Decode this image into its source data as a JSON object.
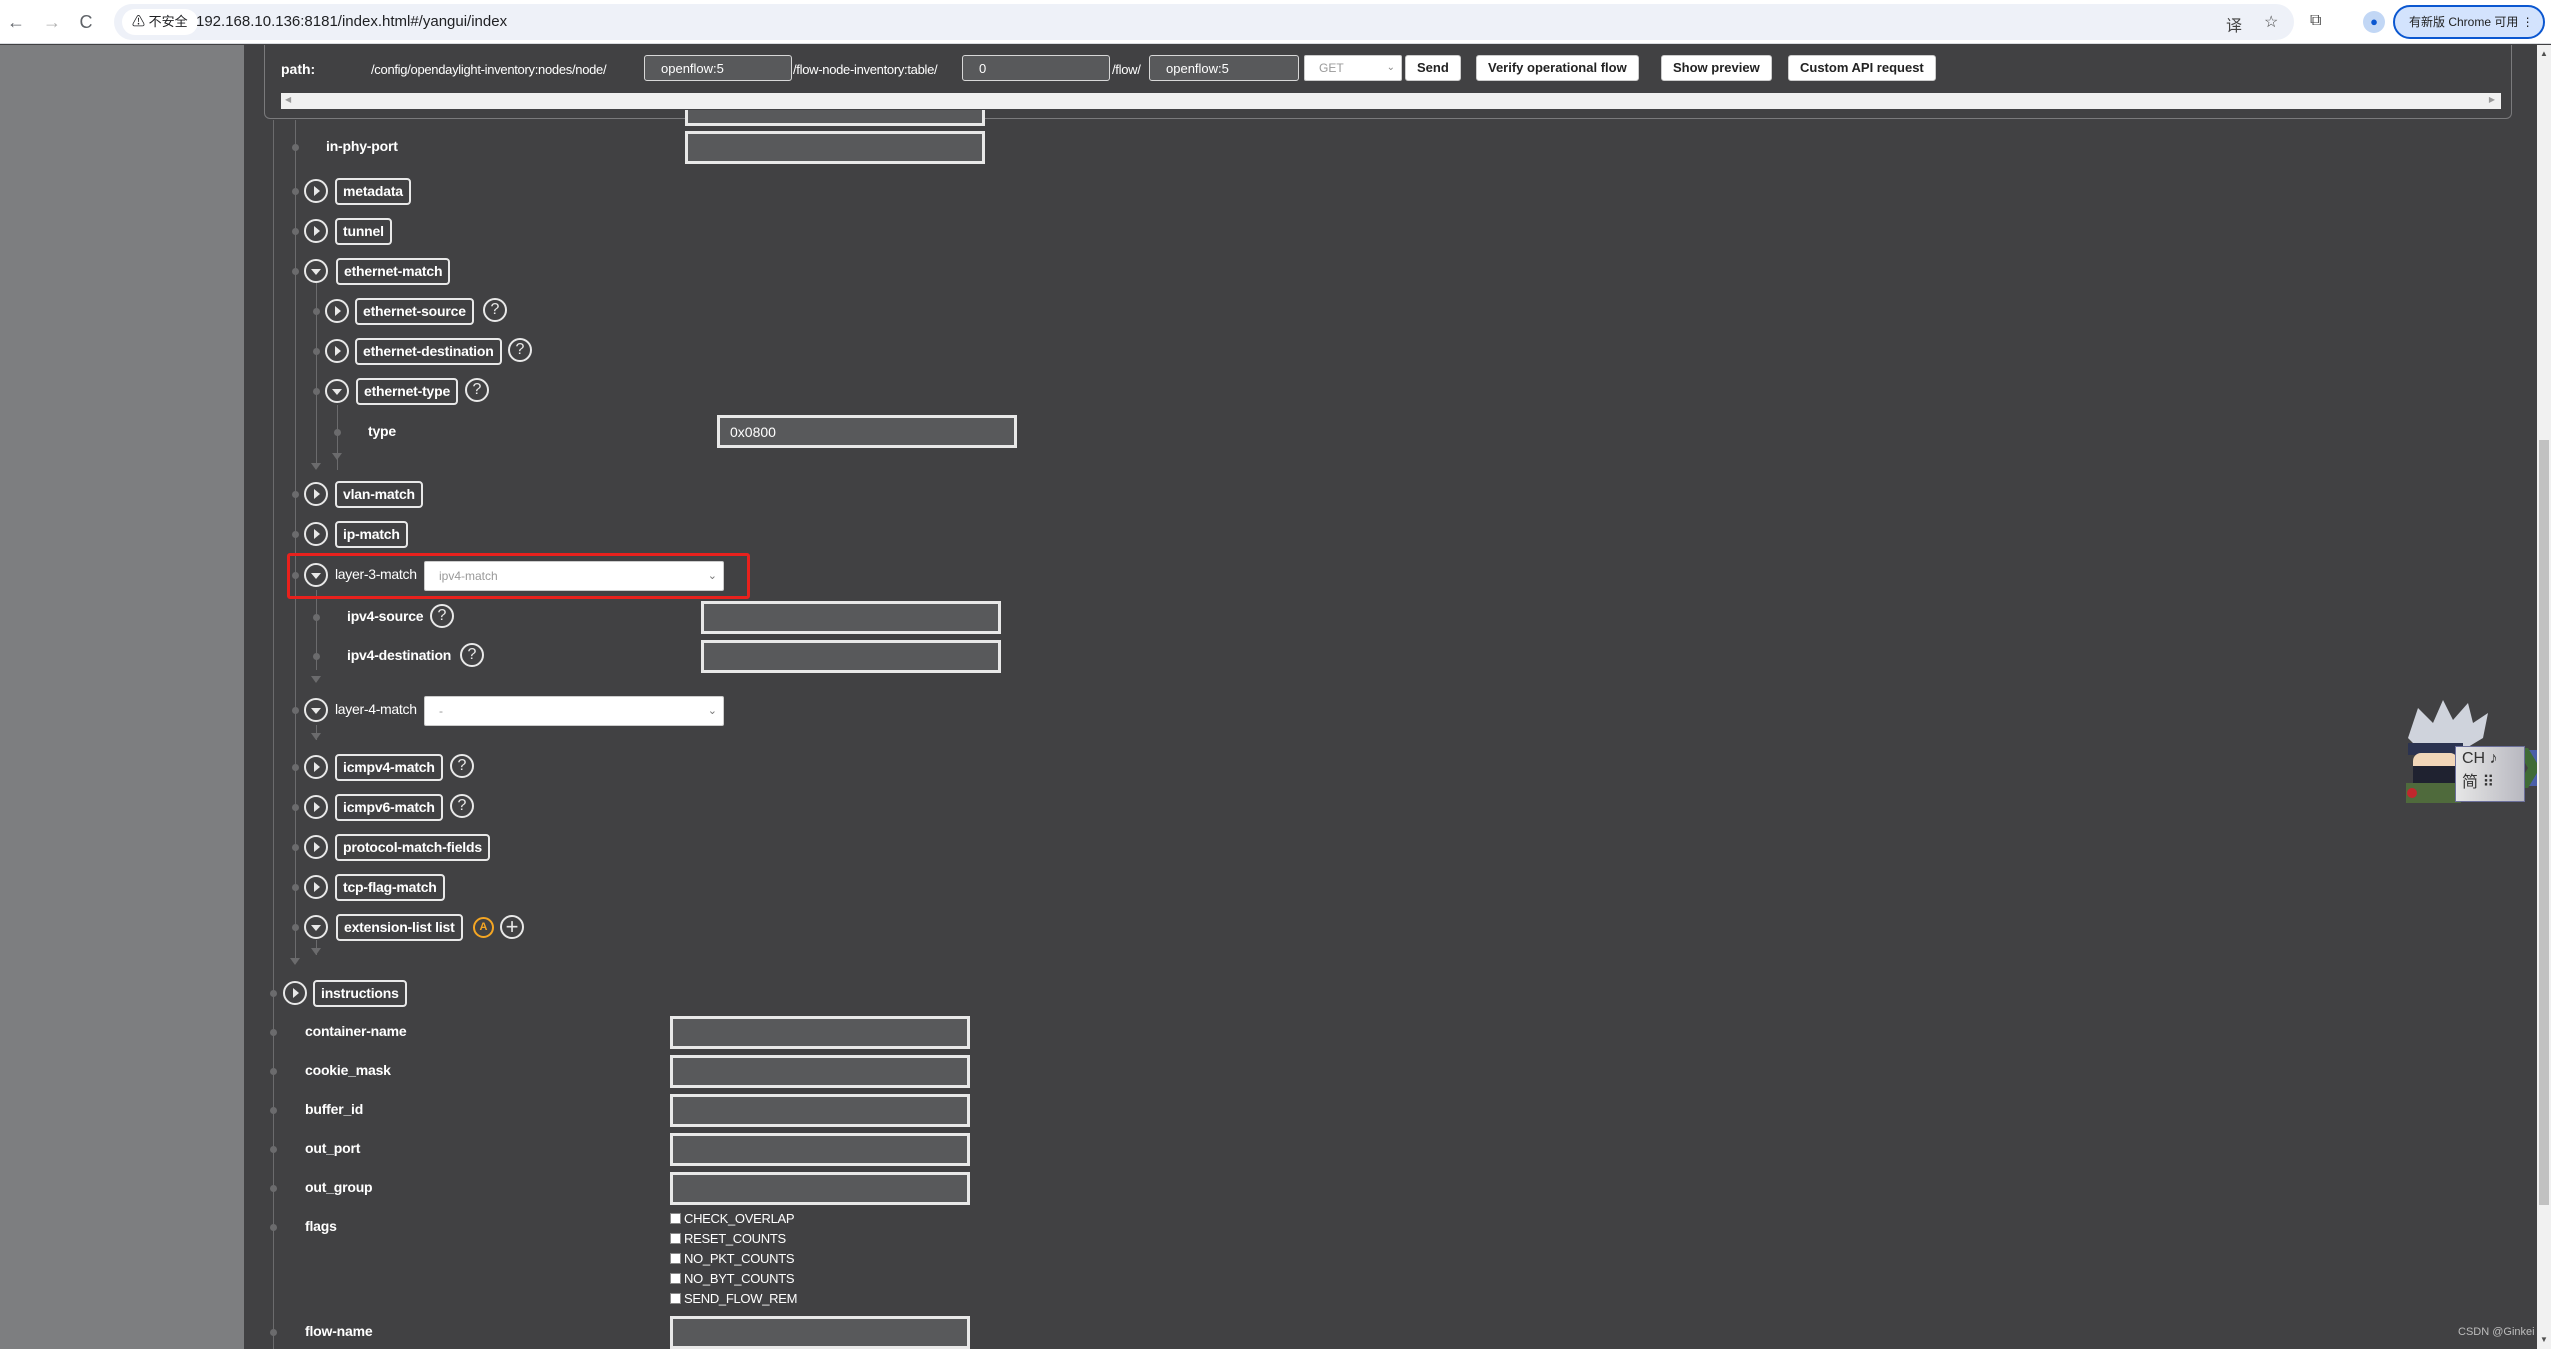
{
  "browser": {
    "back_icon": "←",
    "forward_icon": "→",
    "reload_icon": "C",
    "security_label": "⚠ 不安全",
    "url": "192.168.10.136:8181/index.html#/yangui/index",
    "translate_icon": "译",
    "bookmark_icon": "☆",
    "extensions_icon": "⧉",
    "profile_icon": "👤",
    "update_label": "有新版 Chrome 可用 ⋮"
  },
  "path_bar": {
    "label": "path:",
    "segment1": "/config/opendaylight-inventory:nodes/node/",
    "node_id": "openflow:5",
    "segment2": "/flow-node-inventory:table/",
    "table_id": "0",
    "segment3": "/flow/",
    "flow_id": "openflow:5",
    "method": "GET",
    "buttons": {
      "send": "Send",
      "verify": "Verify operational flow",
      "preview": "Show preview",
      "custom": "Custom API request"
    }
  },
  "tree": {
    "in_phy_port": {
      "label": "in-phy-port",
      "value": ""
    },
    "metadata": "metadata",
    "tunnel": "tunnel",
    "ethernet_match": "ethernet-match",
    "ethernet_source": "ethernet-source",
    "ethernet_destination": "ethernet-destination",
    "ethernet_type": "ethernet-type",
    "type": {
      "label": "type",
      "value": "0x0800"
    },
    "vlan_match": "vlan-match",
    "ip_match": "ip-match",
    "layer3": {
      "label": "layer-3-match",
      "selected": "ipv4-match"
    },
    "ipv4_source": {
      "label": "ipv4-source",
      "value": ""
    },
    "ipv4_destination": {
      "label": "ipv4-destination",
      "value": ""
    },
    "layer4": {
      "label": "layer-4-match",
      "selected": "-"
    },
    "icmpv4_match": "icmpv4-match",
    "icmpv6_match": "icmpv6-match",
    "protocol_match_fields": "protocol-match-fields",
    "tcp_flag_match": "tcp-flag-match",
    "extension_list": "extension-list list",
    "augment_badge": "A",
    "instructions": "instructions",
    "help_glyph": "?",
    "add_glyph": "+"
  },
  "fields": {
    "container_name": {
      "label": "container-name",
      "value": ""
    },
    "cookie_mask": {
      "label": "cookie_mask",
      "value": ""
    },
    "buffer_id": {
      "label": "buffer_id",
      "value": ""
    },
    "out_port": {
      "label": "out_port",
      "value": ""
    },
    "out_group": {
      "label": "out_group",
      "value": ""
    },
    "flags": {
      "label": "flags",
      "options": [
        {
          "label": "CHECK_OVERLAP",
          "checked": false
        },
        {
          "label": "RESET_COUNTS",
          "checked": false
        },
        {
          "label": "NO_PKT_COUNTS",
          "checked": false
        },
        {
          "label": "NO_BYT_COUNTS",
          "checked": false
        },
        {
          "label": "SEND_FLOW_REM",
          "checked": false
        }
      ]
    },
    "flow_name": {
      "label": "flow-name",
      "value": ""
    }
  },
  "ime": {
    "line1": "CH ♪",
    "line2": "简 ⠿"
  },
  "watermark": "CSDN @Ginkei",
  "colors": {
    "highlight": "#e8211d",
    "augment": "#f5a623"
  }
}
